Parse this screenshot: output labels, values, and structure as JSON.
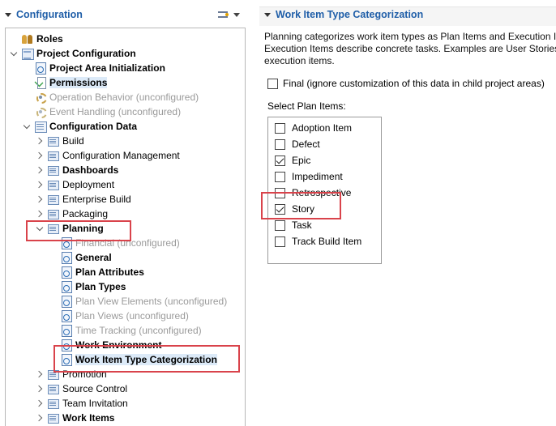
{
  "left": {
    "title": "Configuration",
    "tree": [
      {
        "label": "Roles",
        "icon": "roles-icon",
        "weight": "bold",
        "expand": "none"
      },
      {
        "label": "Project Configuration",
        "icon": "project-config-icon",
        "weight": "bold",
        "expand": "expanded"
      },
      {
        "label": "Project Area Initialization",
        "icon": "page-icon",
        "weight": "bold",
        "expand": "none"
      },
      {
        "label": "Permissions",
        "icon": "permissions-icon",
        "weight": "bold",
        "expand": "none",
        "selected": true
      },
      {
        "label": "Operation Behavior (unconfigured)",
        "icon": "operation-behavior-icon",
        "weight": "gray",
        "expand": "none"
      },
      {
        "label": "Event Handling (unconfigured)",
        "icon": "event-handling-icon",
        "weight": "gray",
        "expand": "none"
      },
      {
        "label": "Configuration Data",
        "icon": "configuration-data-icon",
        "weight": "bold",
        "expand": "expanded"
      },
      {
        "label": "Build",
        "icon": "folder-icon",
        "weight": "normal",
        "expand": "collapsed"
      },
      {
        "label": "Configuration Management",
        "icon": "folder-icon",
        "weight": "normal",
        "expand": "collapsed"
      },
      {
        "label": "Dashboards",
        "icon": "folder-icon",
        "weight": "bold",
        "expand": "collapsed"
      },
      {
        "label": "Deployment",
        "icon": "folder-icon",
        "weight": "normal",
        "expand": "collapsed"
      },
      {
        "label": "Enterprise Build",
        "icon": "folder-icon",
        "weight": "normal",
        "expand": "collapsed"
      },
      {
        "label": "Packaging",
        "icon": "folder-icon",
        "weight": "normal",
        "expand": "collapsed"
      },
      {
        "label": "Planning",
        "icon": "folder-icon",
        "weight": "bold",
        "expand": "expanded"
      },
      {
        "label": "Financial (unconfigured)",
        "icon": "page-icon",
        "weight": "gray",
        "expand": "none"
      },
      {
        "label": "General",
        "icon": "page-icon",
        "weight": "bold",
        "expand": "none"
      },
      {
        "label": "Plan Attributes",
        "icon": "page-icon",
        "weight": "bold",
        "expand": "none"
      },
      {
        "label": "Plan Types",
        "icon": "page-icon",
        "weight": "bold",
        "expand": "none"
      },
      {
        "label": "Plan View Elements (unconfigured)",
        "icon": "page-icon",
        "weight": "gray",
        "expand": "none"
      },
      {
        "label": "Plan Views (unconfigured)",
        "icon": "page-icon",
        "weight": "gray",
        "expand": "none"
      },
      {
        "label": "Time Tracking (unconfigured)",
        "icon": "page-icon",
        "weight": "gray",
        "expand": "none"
      },
      {
        "label": "Work Environment",
        "icon": "page-icon",
        "weight": "bold",
        "expand": "none"
      },
      {
        "label": "Work Item Type Categorization",
        "icon": "page-icon",
        "weight": "bold",
        "expand": "none",
        "selected": true
      },
      {
        "label": "Promotion",
        "icon": "folder-icon",
        "weight": "normal",
        "expand": "collapsed"
      },
      {
        "label": "Source Control",
        "icon": "folder-icon",
        "weight": "normal",
        "expand": "collapsed"
      },
      {
        "label": "Team Invitation",
        "icon": "folder-icon",
        "weight": "normal",
        "expand": "collapsed"
      },
      {
        "label": "Work Items",
        "icon": "folder-icon",
        "weight": "bold",
        "expand": "collapsed"
      }
    ]
  },
  "right": {
    "title": "Work Item Type Categorization",
    "description": [
      "Planning categorizes work item types as Plan Items and Execution Ite",
      "Execution Items describe concrete tasks. Examples are User Stories as",
      "execution items."
    ],
    "final_label": "Final (ignore customization of this data in child project areas)",
    "final_checked": false,
    "select_label": "Select Plan Items:",
    "plan_items": [
      {
        "label": "Adoption Item",
        "checked": false
      },
      {
        "label": "Defect",
        "checked": false
      },
      {
        "label": "Epic",
        "checked": true
      },
      {
        "label": "Impediment",
        "checked": false
      },
      {
        "label": "Retrospective",
        "checked": false
      },
      {
        "label": "Story",
        "checked": true
      },
      {
        "label": "Task",
        "checked": false
      },
      {
        "label": "Track Build Item",
        "checked": false
      }
    ]
  },
  "colors": {
    "section_title": "#1f5ea8",
    "highlight_box": "#d9434b",
    "selection": "#dceaf8"
  }
}
